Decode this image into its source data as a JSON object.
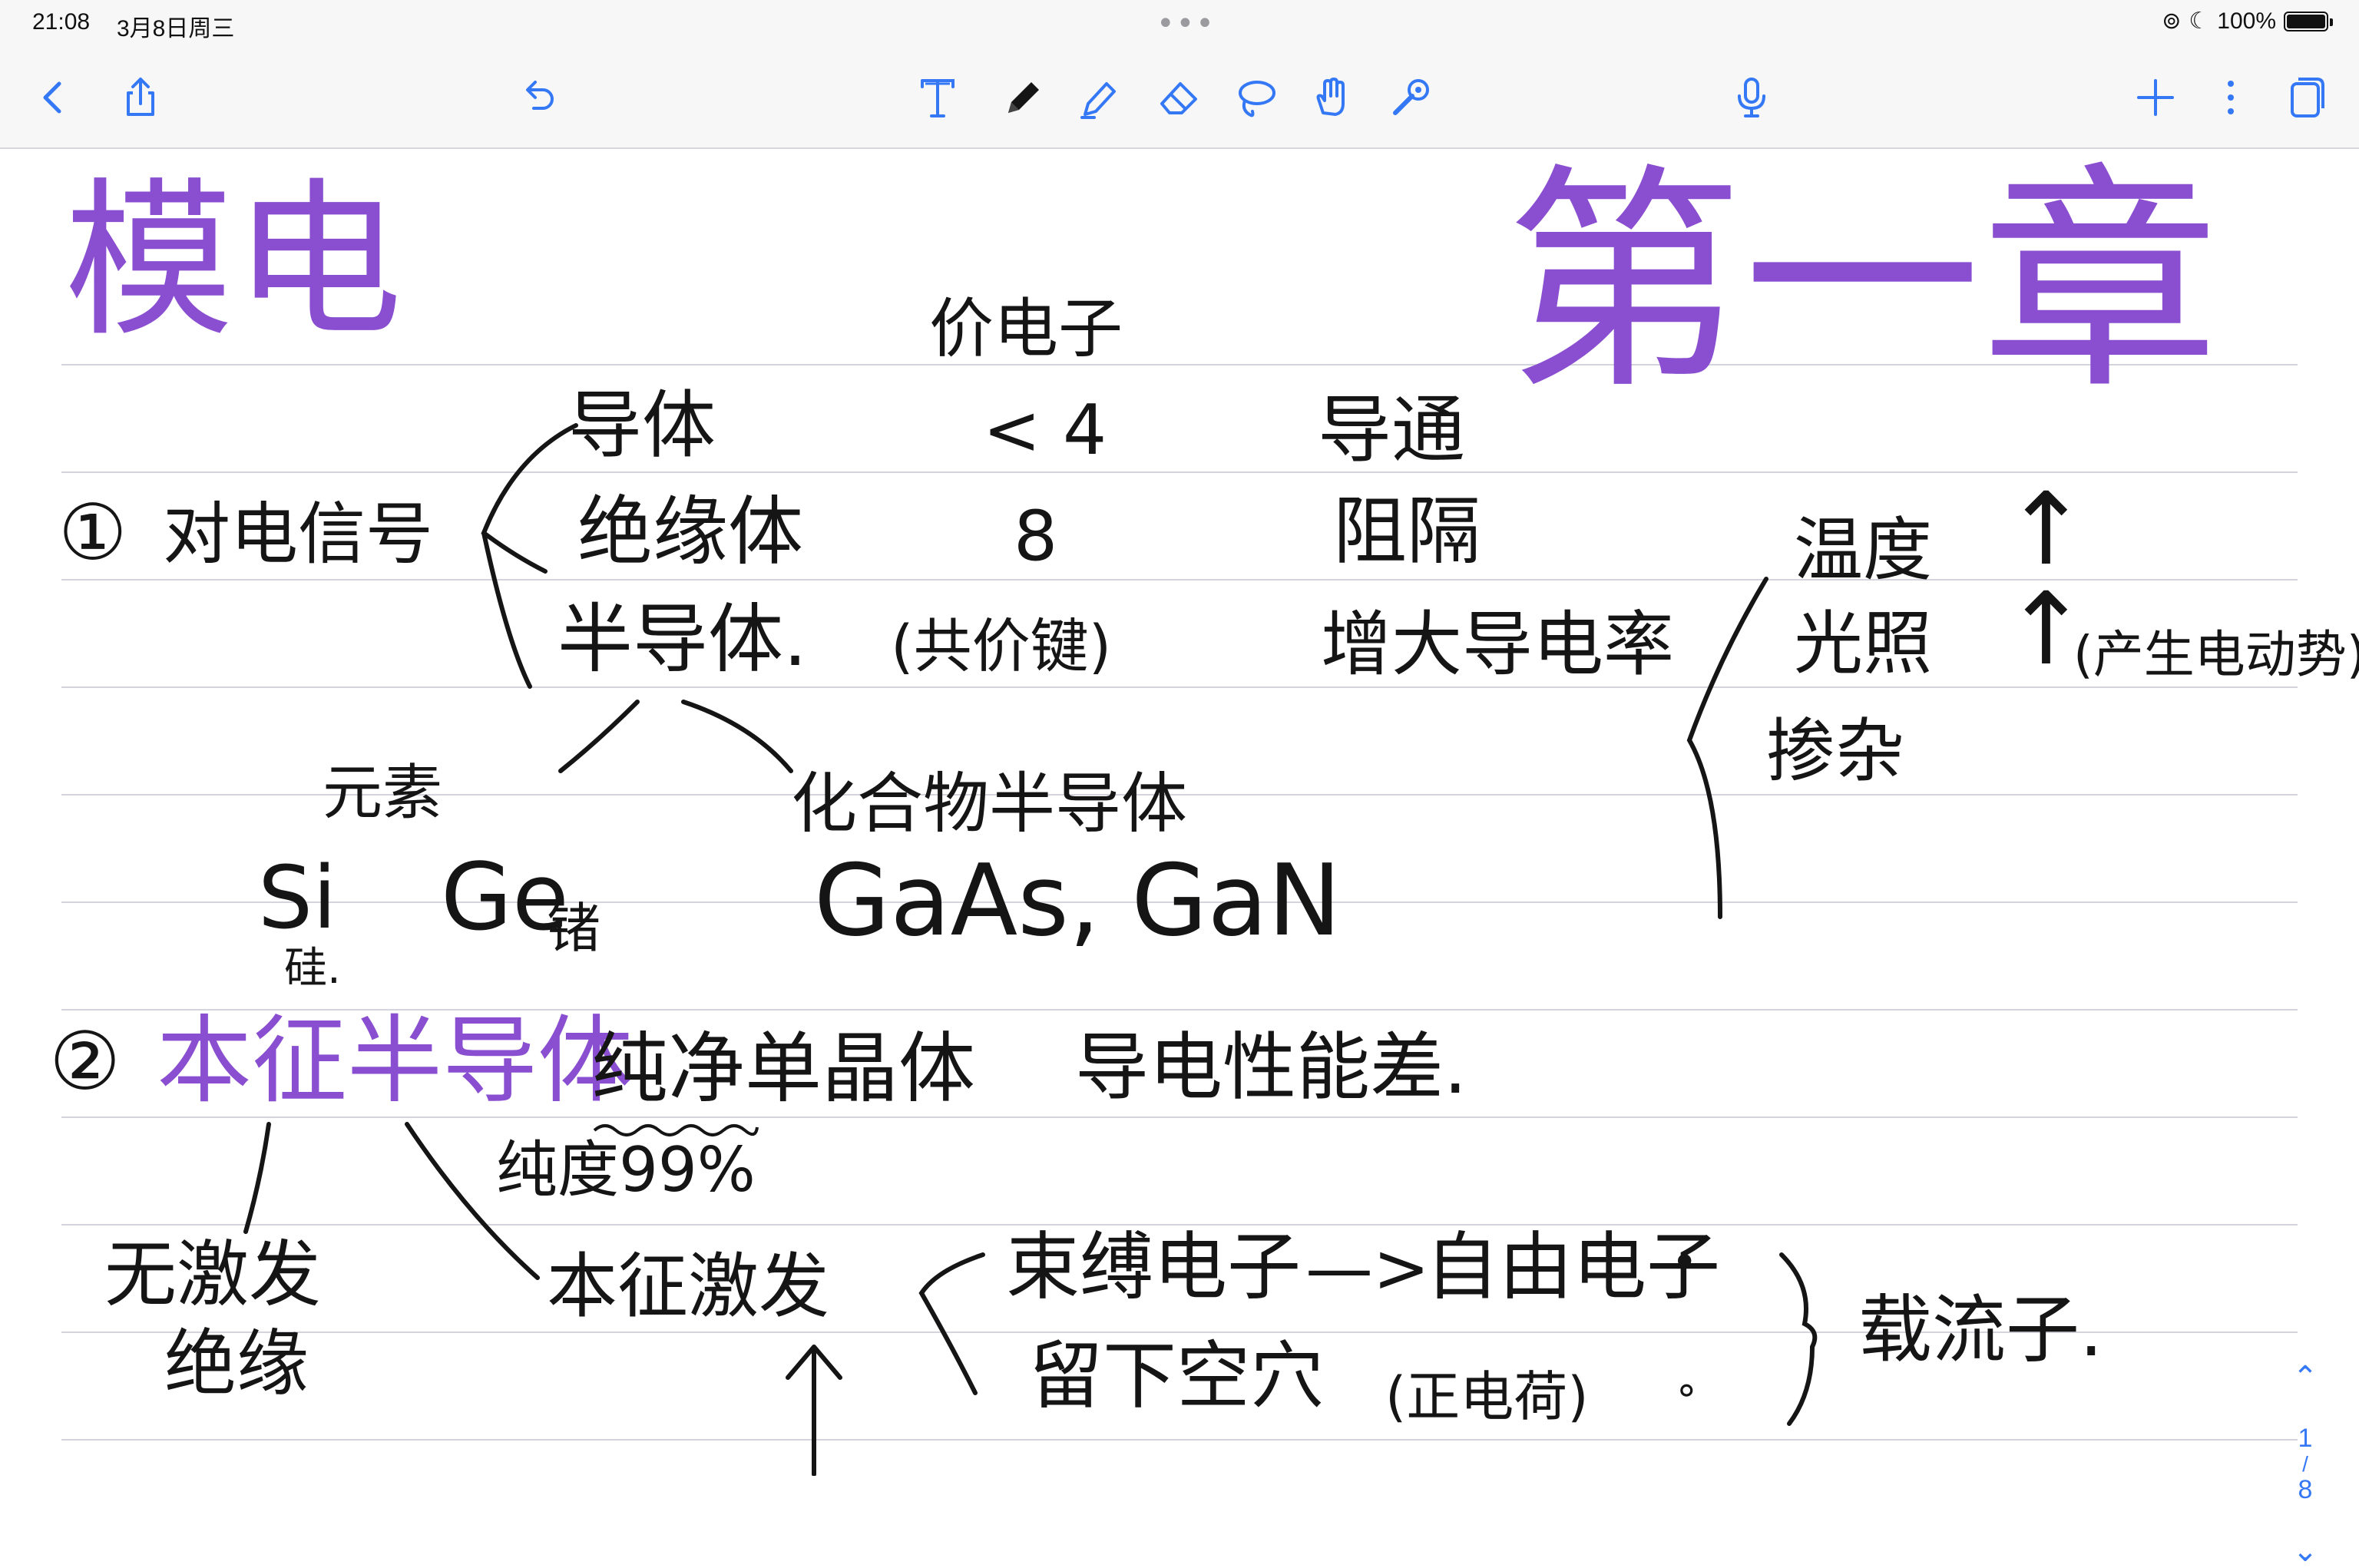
{
  "status": {
    "time": "21:08",
    "date": "3月8日周三",
    "dots": "•••",
    "battery": "100%",
    "battery_level": 1.0
  },
  "toolbar": {
    "icons": [
      "chevron-left-icon",
      "share-icon",
      "undo-icon",
      "text-tool-icon",
      "pen-icon",
      "highlighter-icon",
      "eraser-icon",
      "lasso-icon",
      "hand-icon",
      "laser-icon",
      "microphone-icon",
      "plus-icon",
      "more-icon",
      "pages-icon"
    ],
    "accent": "#3478f6"
  },
  "colors": {
    "ink_black": "#151515",
    "ink_purple": "#8a4fd0",
    "rule": "#d4d4dc"
  },
  "note": {
    "title": "模电",
    "chapter": "第一章",
    "valence_header": "价电子",
    "n1": "①",
    "signal": "对电信号",
    "conductor": "导体",
    "conductor_valence": "< 4",
    "conductor_prop": "导通",
    "insulator": "绝缘体",
    "insulator_valence": "8",
    "insulator_prop": "阻隔",
    "semiconductor": "半导体.",
    "covalent": "(共价键)",
    "increase": "增大导电率",
    "temp": "温度",
    "temp_arrow": "↑",
    "light": "光照",
    "light_arrow": "↑",
    "photo_effect": "(产生电动势)",
    "doping": "掺杂",
    "element": "元素",
    "compound": "化合物半导体",
    "si": "Si",
    "si_cn": "硅.",
    "ge": "Ge",
    "ge_cn": "锗",
    "gaas": "GaAs, GaN",
    "n2": "②",
    "intrinsic": "本征半导体",
    "pure_crystal": "纯净单晶体",
    "poor_conduct": "导电性能差.",
    "purity": "纯度99%",
    "no_excite": "无激发",
    "insulate": "绝缘",
    "intrinsic_excite": "本征激发",
    "bound_e": "束缚电子",
    "arrow": "—>",
    "free_e": "自由电子",
    "dot1": "•",
    "hole": "留下空穴",
    "positive": "(正电荷)",
    "dot2": "∘",
    "carrier": "载流子."
  },
  "pager": {
    "up": "⌃",
    "current": "1",
    "sep": "/",
    "total": "8",
    "down": "⌄"
  }
}
